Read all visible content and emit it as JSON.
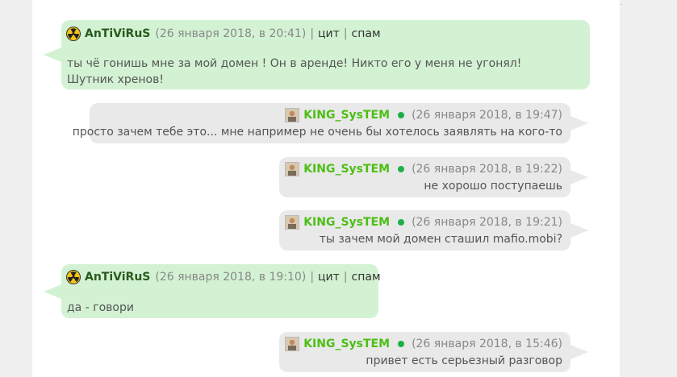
{
  "messages": [
    {
      "author": "AnTiViRuS",
      "date": "(26 января 2018, в 20:41)",
      "action_quote": "цит",
      "action_spam": "спам",
      "separator": "|",
      "text": "ты чё гонишь мне за мой домен ! Он в аренде! Никто его у меня не угонял!Шутник хренов!"
    },
    {
      "author": "KING_SysTEM",
      "date": "(26 января 2018, в 19:47)",
      "text": "просто зачем тебе это... мне например не очень бы хотелось заявлять на кого-то"
    },
    {
      "author": "KING_SysTEM",
      "date": "(26 января 2018, в 19:22)",
      "text": "не хорошо поступаешь"
    },
    {
      "author": "KING_SysTEM",
      "date": "(26 января 2018, в 19:21)",
      "text": "ты зачем мой домен сташил mafio.mobi?"
    },
    {
      "author": "AnTiViRuS",
      "date": "(26 января 2018, в 19:10)",
      "action_quote": "цит",
      "action_spam": "спам",
      "separator": "|",
      "text": "да - говори"
    },
    {
      "author": "KING_SysTEM",
      "date": "(26 января 2018, в 15:46)",
      "text": "привет есть серьезный разговор"
    }
  ],
  "colors": {
    "left_bubble": "#d3f2d3",
    "right_bubble": "#e9e9e9",
    "king_name": "#4cbf14",
    "antivirus_name": "#2a5a1f",
    "online_dot": "#1fae4a"
  },
  "icons": {
    "antivirus_avatar": "radiation-icon",
    "king_avatar": "user-photo-icon",
    "online_status": "online-dot-icon"
  }
}
